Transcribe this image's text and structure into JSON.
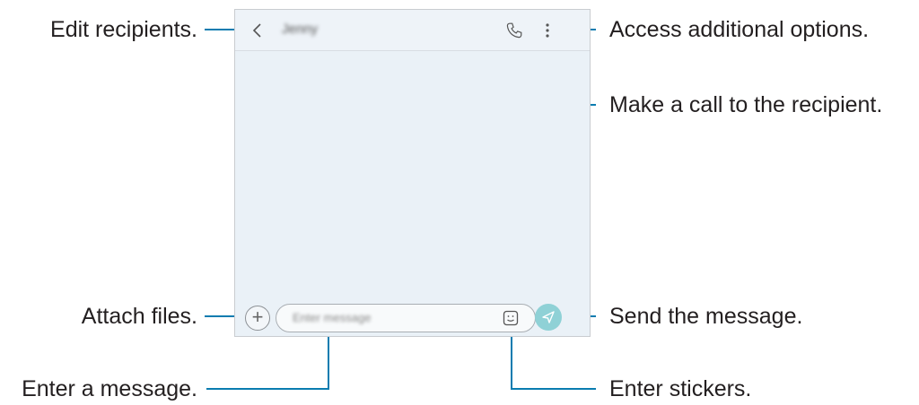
{
  "annotations": {
    "edit_recipients": "Edit recipients.",
    "access_options": "Access additional options.",
    "make_call": "Make a call to the recipient.",
    "attach_files": "Attach files.",
    "send_message": "Send the message.",
    "enter_message": "Enter a message.",
    "enter_stickers": "Enter stickers."
  },
  "screen": {
    "contact_name": "Jenny",
    "message_placeholder": "Enter message"
  },
  "icons": [
    "back-icon",
    "call-icon",
    "more-options-icon",
    "attach-icon",
    "sticker-icon",
    "send-icon"
  ],
  "colors": {
    "leader_line": "#0a7cb0",
    "send_button": "#8fd1d6",
    "screen_background": "#eaf1f7"
  }
}
